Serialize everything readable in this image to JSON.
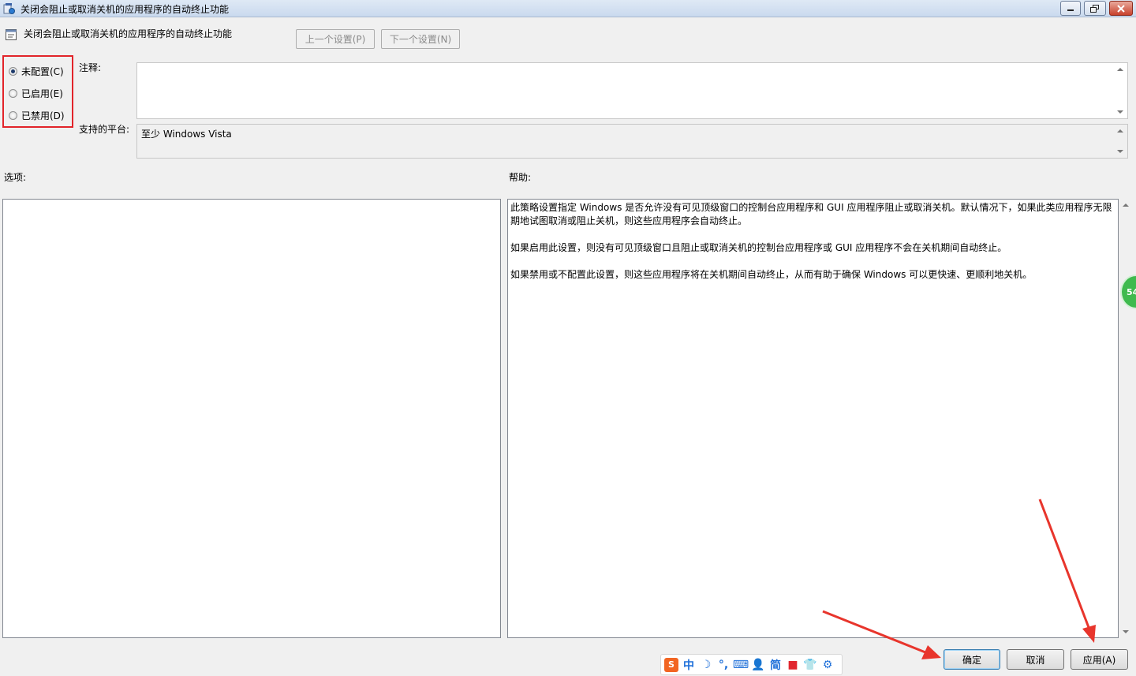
{
  "window": {
    "title": "关闭会阻止或取消关机的应用程序的自动终止功能",
    "icon": "policy-icon",
    "controls": [
      "minimize-icon",
      "restore-icon",
      "close-icon"
    ]
  },
  "header": {
    "title": "关闭会阻止或取消关机的应用程序的自动终止功能",
    "prev_button": "上一个设置(P)",
    "next_button": "下一个设置(N)"
  },
  "state_options": {
    "selected": "not_configured",
    "items": [
      {
        "key": "not_configured",
        "label": "未配置(C)"
      },
      {
        "key": "enabled",
        "label": "已启用(E)"
      },
      {
        "key": "disabled",
        "label": "已禁用(D)"
      }
    ]
  },
  "comment": {
    "label": "注释:",
    "value": ""
  },
  "platform": {
    "label": "支持的平台:",
    "value": "至少 Windows Vista"
  },
  "options": {
    "label": "选项:"
  },
  "help": {
    "label": "帮助:",
    "paragraphs": [
      "此策略设置指定 Windows 是否允许没有可见顶级窗口的控制台应用程序和 GUI 应用程序阻止或取消关机。默认情况下，如果此类应用程序无限期地试图取消或阻止关机，则这些应用程序会自动终止。",
      "如果启用此设置，则没有可见顶级窗口且阻止或取消关机的控制台应用程序或 GUI 应用程序不会在关机期间自动终止。",
      "如果禁用或不配置此设置，则这些应用程序将在关机期间自动终止，从而有助于确保 Windows 可以更快速、更顺利地关机。"
    ]
  },
  "buttons": {
    "ok": "确定",
    "cancel": "取消",
    "apply": "应用(A)"
  },
  "ime_toolbar": {
    "mode": "中",
    "simplified": "简"
  },
  "floating_badge": {
    "text": "54"
  },
  "colors": {
    "highlight_border": "#e2242a",
    "annotation_arrow": "#e8352c"
  }
}
